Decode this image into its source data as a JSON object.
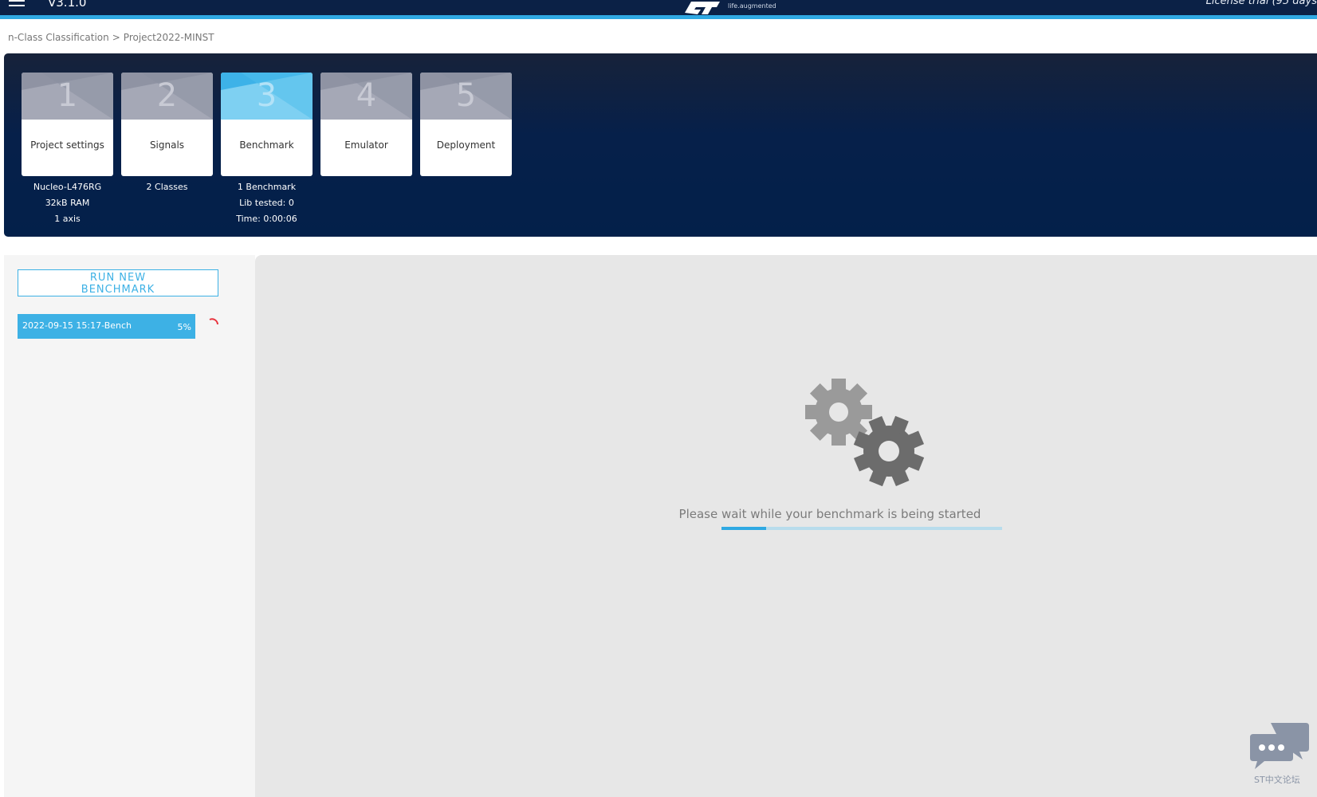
{
  "header": {
    "version": "V3.1.0",
    "logo_tagline": "life.augmented",
    "license": "License trial (95 days"
  },
  "breadcrumb": {
    "items": [
      "n-Class Classification",
      "Project2022-MINST"
    ],
    "separator": ">"
  },
  "steps": [
    {
      "number": "1",
      "label": "Project settings",
      "info": [
        "Nucleo-L476RG",
        "32kB RAM",
        "1 axis"
      ]
    },
    {
      "number": "2",
      "label": "Signals",
      "info": [
        "2 Classes"
      ]
    },
    {
      "number": "3",
      "label": "Benchmark",
      "info": [
        "1 Benchmark",
        "Lib tested: 0",
        "Time: 0:00:06"
      ],
      "active": true
    },
    {
      "number": "4",
      "label": "Emulator",
      "info": []
    },
    {
      "number": "5",
      "label": "Deployment",
      "info": []
    }
  ],
  "sidebar": {
    "run_button_line1": "RUN NEW",
    "run_button_line2": "BENCHMARK",
    "benchmarks": [
      {
        "name": "2022-09-15 15:17-Bench",
        "progress_label": "5%",
        "progress": 5
      }
    ]
  },
  "main": {
    "wait_message": "Please wait while your benchmark is being started",
    "progress": 0.16
  },
  "chat_widget": {
    "label": "ST中文论坛"
  },
  "colors": {
    "header": "#0b2146",
    "accent": "#2fa9e3",
    "panel": "#06204a",
    "spinner": "#e8333d"
  },
  "icons": [
    "menu-icon",
    "st-logo",
    "gears-icon",
    "spinner-icon",
    "chat-icon"
  ]
}
